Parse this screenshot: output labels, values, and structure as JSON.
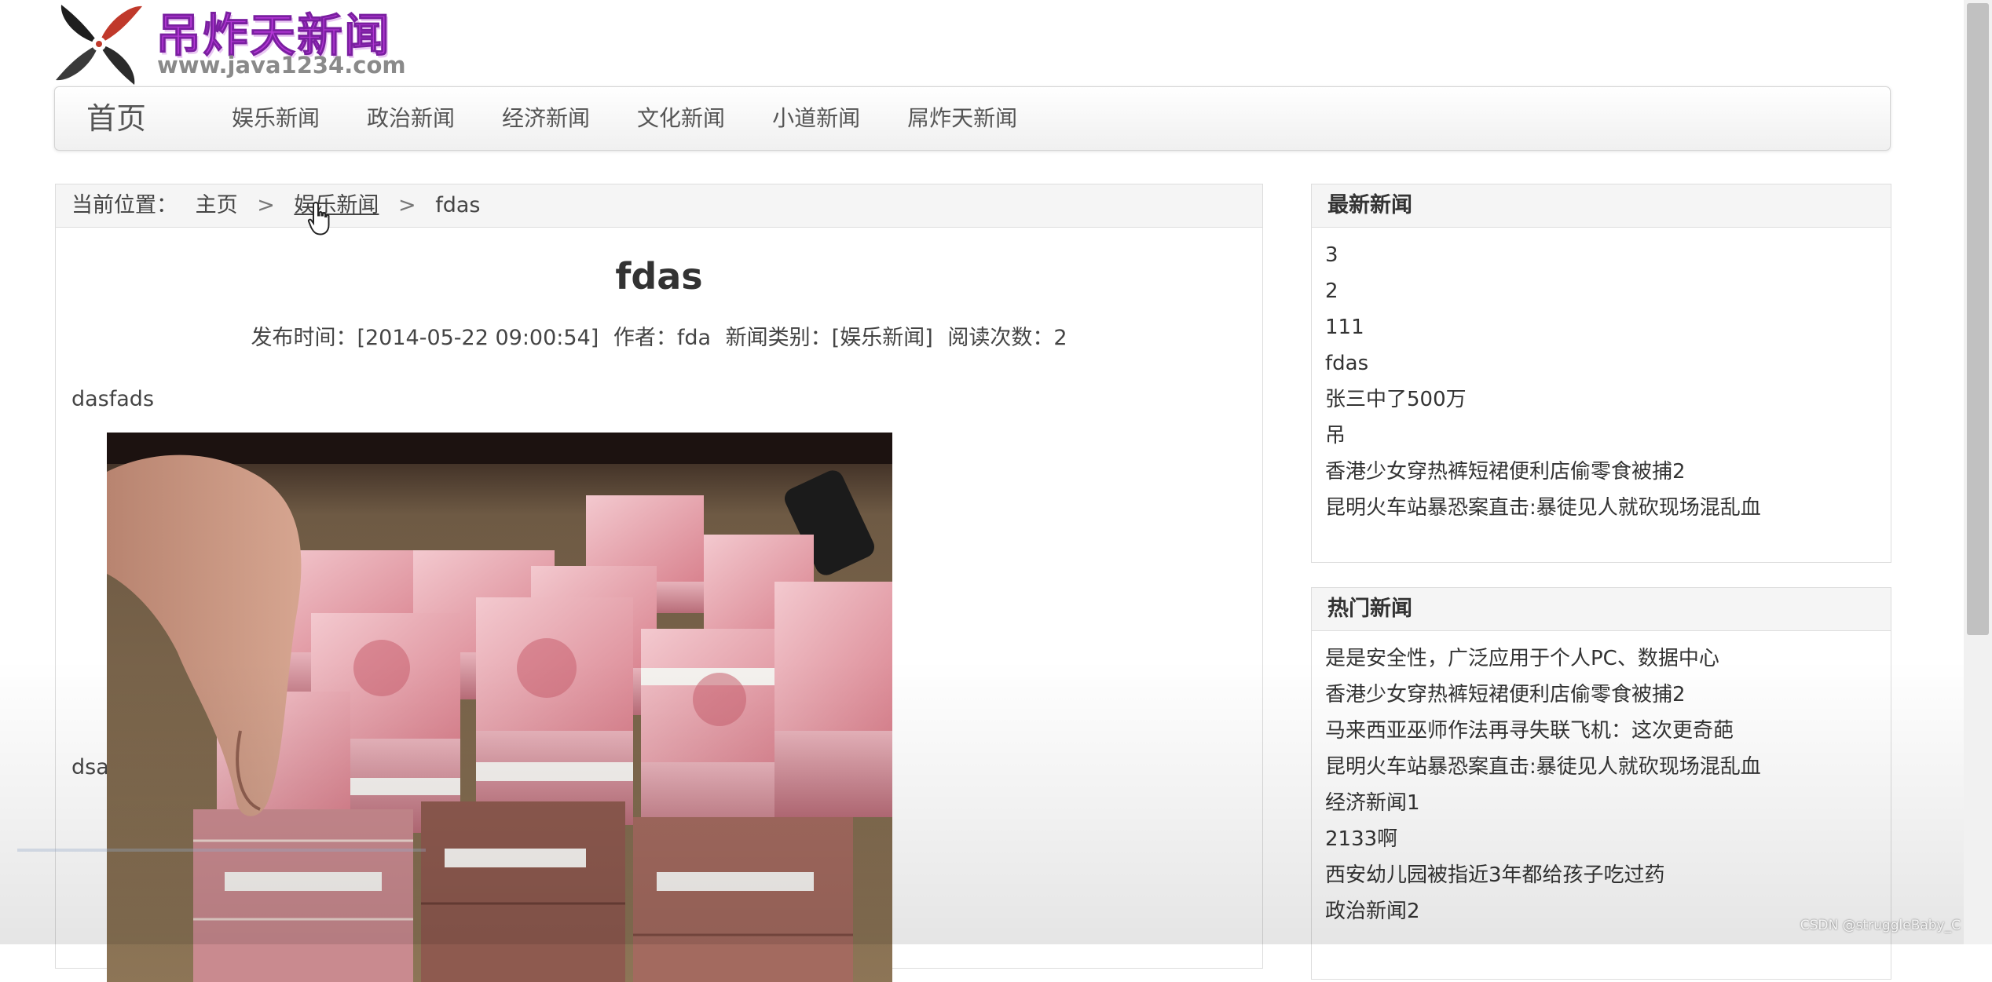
{
  "logo": {
    "title": "吊炸天新闻",
    "url": "www.java1234.com"
  },
  "navbar": {
    "brand": "首页",
    "items": [
      {
        "label": "娱乐新闻"
      },
      {
        "label": "政治新闻"
      },
      {
        "label": "经济新闻"
      },
      {
        "label": "文化新闻"
      },
      {
        "label": "小道新闻"
      },
      {
        "label": "屌炸天新闻"
      }
    ]
  },
  "breadcrumb": {
    "prefix": "当前位置：",
    "home": "主页",
    "category": "娱乐新闻",
    "current": "fdas",
    "separator": ">"
  },
  "article": {
    "title": "fdas",
    "publish_label": "发布时间：[2014-05-22 09:00:54]",
    "author_label": "作者：fda",
    "category_label": "新闻类别：[娱乐新闻]",
    "reads_label": "阅读次数：2",
    "body_text": "dasfads",
    "body_text_after_image": "dsa"
  },
  "latest_news": {
    "title": "最新新闻",
    "items": [
      "3",
      "2",
      "111",
      "fdas",
      "张三中了500万",
      "吊",
      "香港少女穿热裤短裙便利店偷零食被捕2",
      "昆明火车站暴恐案直击:暴徒见人就砍现场混乱血"
    ]
  },
  "hot_news": {
    "title": "热门新闻",
    "items": [
      "是是安全性，广泛应用于个人PC、数据中心",
      "香港少女穿热裤短裙便利店偷零食被捕2",
      "马来西亚巫师作法再寻失联飞机：这次更奇葩",
      "昆明火车站暴恐案直击:暴徒见人就砍现场混乱血",
      "经济新闻1",
      "2133啊",
      "西安幼儿园被指近3年都给孩子吃过药",
      "政治新闻2"
    ]
  },
  "watermark": "CSDN @struggleBaby_C",
  "colors": {
    "logo_purple": "#b437d6",
    "panel_header_bg": "#f5f5f5",
    "border": "#dddddd",
    "text": "#333333"
  },
  "icons": {
    "logo": "pinwheel-logo-icon",
    "cursor": "hand-pointer-icon"
  }
}
